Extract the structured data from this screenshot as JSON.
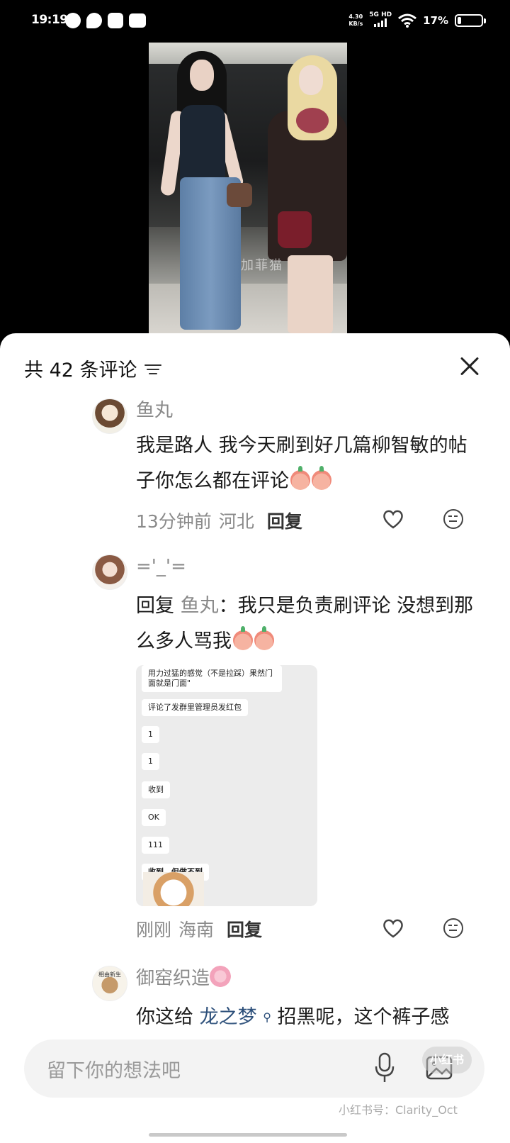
{
  "status_bar": {
    "time": "19:19",
    "speed_value": "4.30",
    "speed_unit": "KB/s",
    "network": "5G HD",
    "battery_text": "17%",
    "battery_level": 0.17
  },
  "photo": {
    "watermark": "加菲猫"
  },
  "comments_panel": {
    "title": "共 42 条评论",
    "comments": [
      {
        "name": "鱼丸",
        "text": "我是路人 我今天刷到好几篇柳智敏的帖子你怎么都在评论",
        "time": "13分钟前",
        "location": "河北",
        "reply_label": "回复"
      },
      {
        "name": "='_'=",
        "reply_prefix": "回复",
        "reply_to": "鱼丸",
        "text": "：我只是负责刷评论 没想到那么多人骂我",
        "time": "刚刚",
        "location": "海南",
        "reply_label": "回复",
        "screenshot_lines": [
          "用力过猛的感觉（不是拉踩）果然门面就是门面\"",
          "评论了发群里管理员发红包",
          "1",
          "1",
          "收到",
          "OK",
          "111",
          "收到，但做不到"
        ]
      },
      {
        "name": "御窑织造",
        "avatar_label": "相由新生",
        "text_prefix": "你这给",
        "mention": "龙之梦",
        "text_suffix": "招黑呢，这个裤子感"
      }
    ]
  },
  "input": {
    "placeholder": "留下你的想法吧"
  },
  "watermark": {
    "logo_text": "小红书",
    "text": "小红书号：Clarity_Oct"
  }
}
